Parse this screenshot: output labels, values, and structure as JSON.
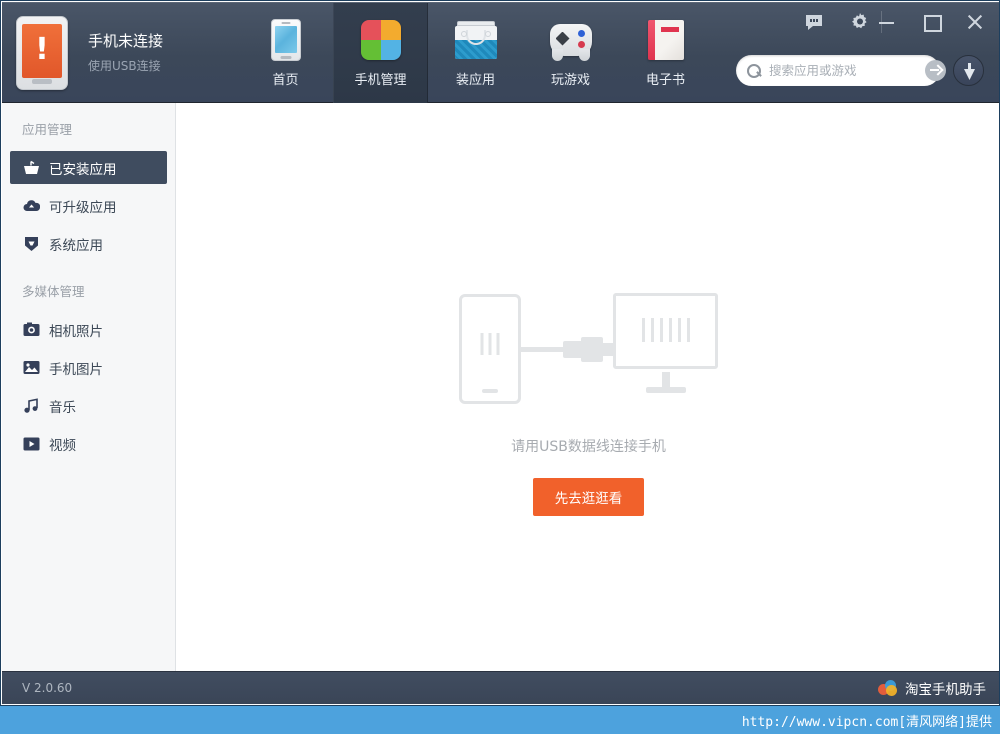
{
  "window": {
    "status": {
      "title": "手机未连接",
      "subtitle": "使用USB连接",
      "icon": "phone-alert-icon"
    },
    "titlebar": {
      "feedback_icon": "message-bubble-icon",
      "settings_icon": "gear-icon",
      "minimize_icon": "minimize-icon",
      "maximize_icon": "maximize-icon",
      "close_icon": "close-icon"
    }
  },
  "nav": {
    "tabs": [
      {
        "label": "首页",
        "icon": "phone-home-icon",
        "active": false
      },
      {
        "label": "手机管理",
        "icon": "four-squares-icon",
        "active": true
      },
      {
        "label": "装应用",
        "icon": "shopping-bag-icon",
        "active": false
      },
      {
        "label": "玩游戏",
        "icon": "gamepad-icon",
        "active": false
      },
      {
        "label": "电子书",
        "icon": "book-icon",
        "active": false
      }
    ]
  },
  "search": {
    "placeholder": "搜索应用或游戏",
    "value": "",
    "icon": "search-icon",
    "submit_icon": "arrow-right-circle-icon"
  },
  "download_button": {
    "icon": "download-arrow-icon"
  },
  "sidebar": {
    "sections": [
      {
        "title": "应用管理",
        "items": [
          {
            "label": "已安装应用",
            "icon": "installed-apps-icon",
            "active": true
          },
          {
            "label": "可升级应用",
            "icon": "upgrade-cloud-icon",
            "active": false
          },
          {
            "label": "系统应用",
            "icon": "shield-icon",
            "active": false
          }
        ]
      },
      {
        "title": "多媒体管理",
        "items": [
          {
            "label": "相机照片",
            "icon": "camera-icon",
            "active": false
          },
          {
            "label": "手机图片",
            "icon": "picture-icon",
            "active": false
          },
          {
            "label": "音乐",
            "icon": "music-note-icon",
            "active": false
          },
          {
            "label": "视频",
            "icon": "video-play-icon",
            "active": false
          }
        ]
      }
    ]
  },
  "content": {
    "graphic": {
      "phone_icon": "phone-outline-icon",
      "cable_icon": "usb-cable-icon",
      "monitor_icon": "monitor-outline-icon"
    },
    "message": "请用USB数据线连接手机",
    "button_label": "先去逛逛看"
  },
  "footer": {
    "version": "V 2.0.60",
    "brand_name": "淘宝手机助手",
    "brand_logo_icon": "taobao-circles-icon"
  },
  "watermark": "http://www.vipcn.com[清风网络]提供",
  "colors": {
    "header_bg": "#3c4859",
    "active_tab_bg": "#2f3a49",
    "sidebar_bg": "#f6f7f8",
    "sidebar_active": "#3f4c5f",
    "accent_orange": "#f1612b",
    "watermark_bg": "#4da2dd",
    "alert_orange": "#e1572a"
  }
}
